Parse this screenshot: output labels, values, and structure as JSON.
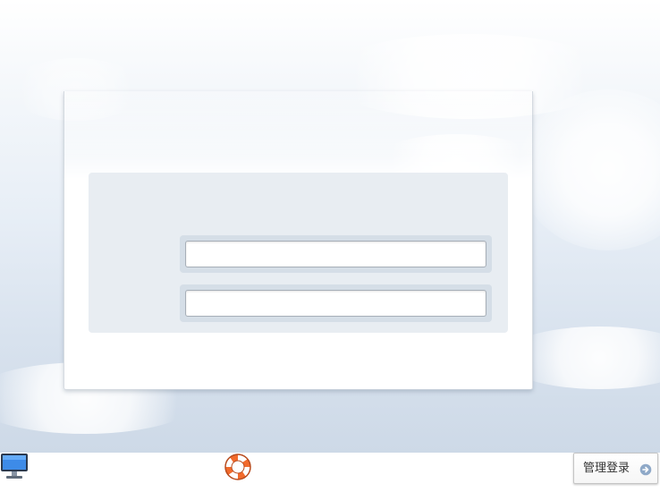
{
  "login_form": {
    "username_value": "",
    "password_value": ""
  },
  "footer": {
    "admin_login_label": "管理登录",
    "icons": {
      "monitor": "monitor-icon",
      "help": "lifebuoy-icon",
      "arrow": "arrow-right-circle-icon"
    }
  },
  "colors": {
    "sky_top": "#ffffff",
    "sky_bottom": "#cdd9e7",
    "panel": "#e8edf2",
    "field_frame": "#d5dee7",
    "lifebuoy_orange": "#f26a2b",
    "arrow_blue": "#8fa9c8"
  }
}
